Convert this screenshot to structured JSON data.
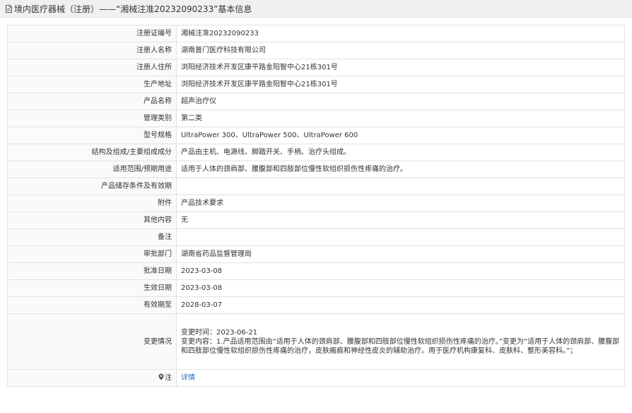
{
  "header": {
    "title": "境内医疗器械（注册）——“湘械注准20232090233”基本信息"
  },
  "rows": [
    {
      "label": "注册证编号",
      "value": "湘械注准20232090233"
    },
    {
      "label": "注册人名称",
      "value": "湖南普门医疗科技有限公司"
    },
    {
      "label": "注册人住所",
      "value": "浏阳经济技术开发区康平路金阳智中心21栋301号"
    },
    {
      "label": "生产地址",
      "value": "浏阳经济技术开发区康平路金阳智中心21栋301号"
    },
    {
      "label": "产品名称",
      "value": "超声治疗仪"
    },
    {
      "label": "管理类别",
      "value": "第二类"
    },
    {
      "label": "型号规格",
      "value": "UltraPower 300、UltraPower 500、UltraPower 600"
    },
    {
      "label": "结构及组成/主要组成成分",
      "value": "产品由主机、电源线、脚踏开关、手柄、治疗头组成。"
    },
    {
      "label": "适用范围/预期用途",
      "value": "适用于人体的颈肩部、腰腹部和四肢部位慢性软组织损伤性疼痛的治疗。"
    },
    {
      "label": "产品储存条件及有效期",
      "value": ""
    },
    {
      "label": "附件",
      "value": "产品技术要求"
    },
    {
      "label": "其他内容",
      "value": "无"
    },
    {
      "label": "备注",
      "value": ""
    },
    {
      "label": "审批部门",
      "value": "湖南省药品监督管理局"
    },
    {
      "label": "批准日期",
      "value": "2023-03-08"
    },
    {
      "label": "生效日期",
      "value": "2023-03-08"
    },
    {
      "label": "有效期至",
      "value": "2028-03-07"
    }
  ],
  "change": {
    "label": "变更情况",
    "time_line": "变更时间：2023-06-21",
    "content_line": "变更内容：1.产品适用范围由“适用于人体的颈肩部、腰腹部和四肢部位慢性软组织损伤性疼痛的治疗。”变更为“适用于人体的颈肩部、腰腹部和四肢部位慢性软组织损伤性疼痛的治疗，皮肤瘢痕和神经性皮炎的辅助治疗。用于医疗机构康复科、皮肤科、整形美容科。”；"
  },
  "note": {
    "label": "注",
    "link_text": "详情"
  },
  "colors": {
    "header_bg": "#f0f0f0",
    "border": "#e2e2e2",
    "link": "#2a6bb8"
  }
}
